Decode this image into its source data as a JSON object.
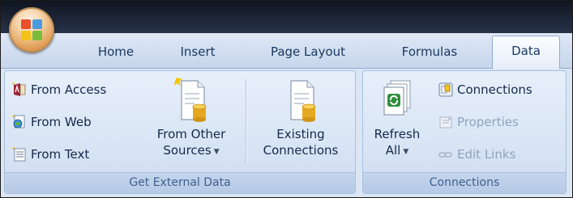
{
  "tabs": [
    {
      "label": "Home"
    },
    {
      "label": "Insert"
    },
    {
      "label": "Page Layout"
    },
    {
      "label": "Formulas"
    },
    {
      "label": "Data",
      "active": true
    }
  ],
  "groups": {
    "get_external_data": {
      "label": "Get External Data",
      "from_access": "From Access",
      "from_web": "From Web",
      "from_text": "From Text",
      "from_other_line1": "From Other",
      "from_other_line2": "Sources",
      "existing_line1": "Existing",
      "existing_line2": "Connections"
    },
    "connections": {
      "label": "Connections",
      "refresh_line1": "Refresh",
      "refresh_line2": "All",
      "connections": "Connections",
      "properties": "Properties",
      "edit_links": "Edit Links"
    }
  },
  "icons": {
    "office_button": "office-logo-icon",
    "from_access": "access-icon",
    "from_web": "web-icon",
    "from_text": "text-file-icon",
    "from_other_sources": "database-document-icon",
    "existing_connections": "database-document-icon",
    "refresh_all": "refresh-icon",
    "connections": "connections-icon",
    "properties": "properties-icon",
    "edit_links": "edit-links-icon"
  },
  "colors": {
    "title_bar": "#1a2333",
    "ribbon_background": "#dbe6f4",
    "tab_text": "#17375e",
    "group_label_text": "#3e5f8f",
    "disabled_text": "#8ea3bf"
  }
}
